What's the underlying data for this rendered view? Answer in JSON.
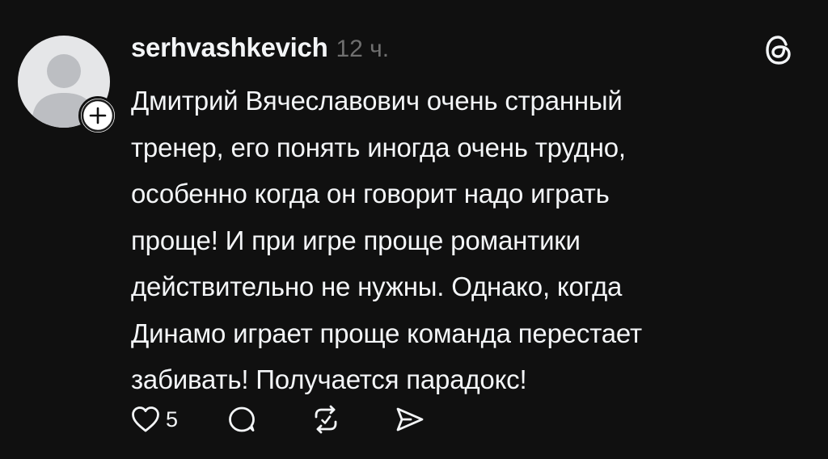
{
  "post": {
    "username": "serhvashkevich",
    "timestamp": "12 ч.",
    "text": "Дмитрий Вячеславович очень странный\nтренер, его понять иногда очень трудно,\nособенно когда он говорит надо играть\nпроще! И при игре проще романтики\nдействительно не нужны. Однако, когда\nДинамо играет проще команда перестает\nзабивать! Получается парадокс!",
    "like_count": "5"
  },
  "icons": {
    "avatar": "default-avatar-icon",
    "follow": "plus-icon",
    "brand": "threads-logo-icon",
    "like": "heart-icon",
    "comment": "comment-icon",
    "repost": "repost-icon",
    "share": "send-icon"
  },
  "colors": {
    "background": "#101010",
    "text": "#f3f5f7",
    "secondary_text": "#6f6f6f",
    "avatar_bg": "#e5e6e8",
    "avatar_figure": "#bcbec2"
  }
}
